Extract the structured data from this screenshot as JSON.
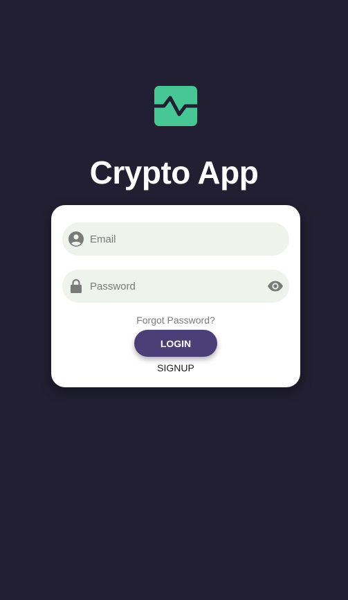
{
  "app": {
    "title": "Crypto App",
    "logo_icon": "pulse-line-icon"
  },
  "login_form": {
    "email": {
      "placeholder": "Email",
      "value": "",
      "icon": "account-circle-icon"
    },
    "password": {
      "placeholder": "Password",
      "value": "",
      "icon": "lock-icon",
      "toggle_icon": "eye-icon"
    },
    "forgot_label": "Forgot Password?",
    "login_label": "LOGIN",
    "signup_label": "SIGNUP"
  },
  "colors": {
    "background": "#211f31",
    "accent": "#48c796",
    "button": "#4b3f78",
    "field_bg": "#eef4ec"
  }
}
